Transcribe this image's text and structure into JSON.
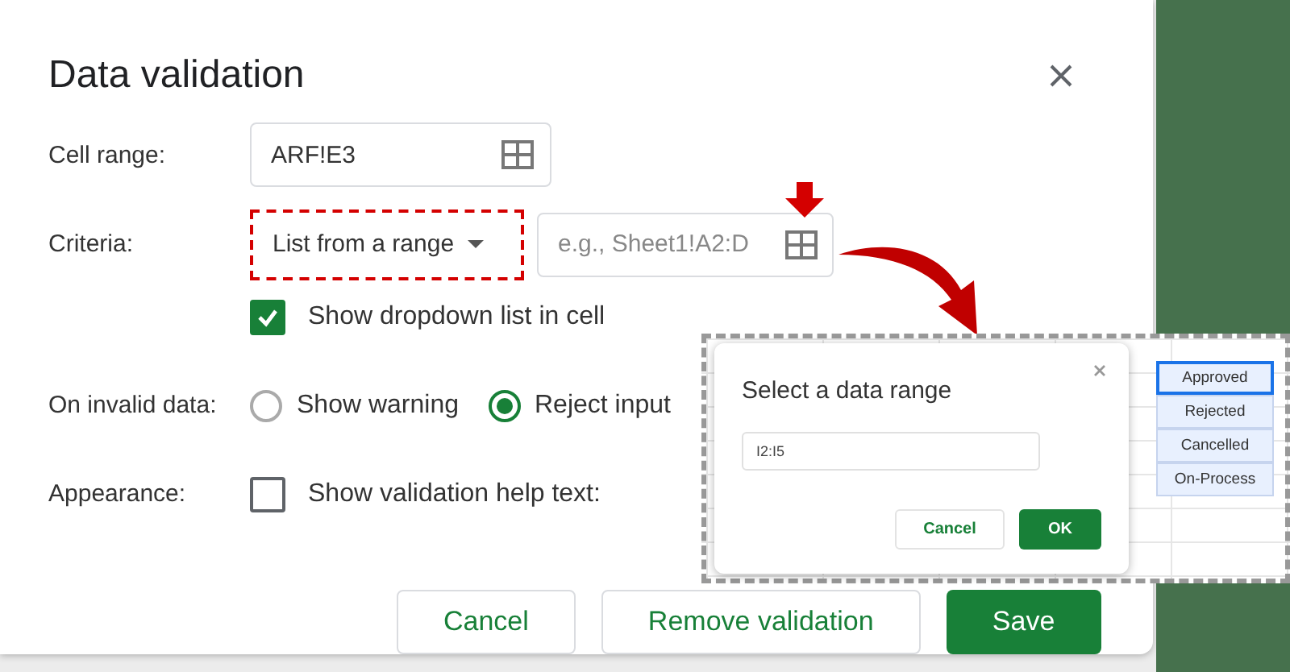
{
  "dialog": {
    "title": "Data validation",
    "cell_range": {
      "label": "Cell range:",
      "value": "ARF!E3"
    },
    "criteria": {
      "label": "Criteria:",
      "dropdown": "List from a range",
      "placeholder": "e.g., Sheet1!A2:D"
    },
    "show_dropdown": {
      "label": "Show dropdown list in cell",
      "checked": true
    },
    "invalid_data": {
      "label": "On invalid data:",
      "options": [
        {
          "label": "Show warning",
          "selected": false
        },
        {
          "label": "Reject input",
          "selected": true
        }
      ]
    },
    "appearance": {
      "label": "Appearance:",
      "checkbox_label": "Show validation help text:",
      "checked": false
    },
    "buttons": [
      {
        "label": "Cancel",
        "kind": "secondary"
      },
      {
        "label": "Remove validation",
        "kind": "secondary"
      },
      {
        "label": "Save",
        "kind": "primary"
      }
    ]
  },
  "range_dialog": {
    "title": "Select a data range",
    "value": "I2:I5",
    "buttons": [
      {
        "label": "Cancel",
        "kind": "secondary"
      },
      {
        "label": "OK",
        "kind": "primary"
      }
    ]
  },
  "sheet_cells": [
    {
      "text": "Approved",
      "selected": true
    },
    {
      "text": "Rejected",
      "selected": false
    },
    {
      "text": "Cancelled",
      "selected": false
    },
    {
      "text": "On-Process",
      "selected": false
    }
  ]
}
